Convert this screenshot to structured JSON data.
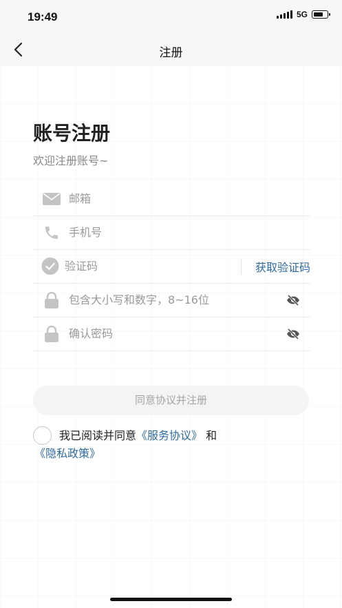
{
  "status_bar": {
    "time": "19:49",
    "network": "5G",
    "battery_level": 0.75
  },
  "nav": {
    "title": "注册",
    "back_icon": "chevron-left-icon"
  },
  "page": {
    "title": "账号注册",
    "subtitle": "欢迎注册账号~"
  },
  "form": {
    "email": {
      "placeholder": "邮箱",
      "value": "",
      "icon": "mail-icon"
    },
    "phone": {
      "placeholder": "手机号",
      "value": "",
      "icon": "phone-icon"
    },
    "code": {
      "placeholder": "验证码",
      "value": "",
      "icon": "check-circle-icon",
      "get_code_label": "获取验证码"
    },
    "password": {
      "placeholder": "包含大小写和数字，8~16位",
      "value": "",
      "icon": "lock-icon",
      "toggle_icon": "eye-off-icon"
    },
    "confirm_password": {
      "placeholder": "确认密码",
      "value": "",
      "icon": "lock-icon",
      "toggle_icon": "eye-off-icon"
    }
  },
  "submit_label": "同意协议并注册",
  "agreement": {
    "prefix": "我已阅读并同意",
    "service_link": "《服务协议》",
    "conjunction": "和",
    "privacy_link": "《隐私政策》",
    "checked": false
  },
  "colors": {
    "link": "#2d6aa3",
    "icon_gray": "#c4c4c4",
    "eye_icon": "#555555"
  }
}
